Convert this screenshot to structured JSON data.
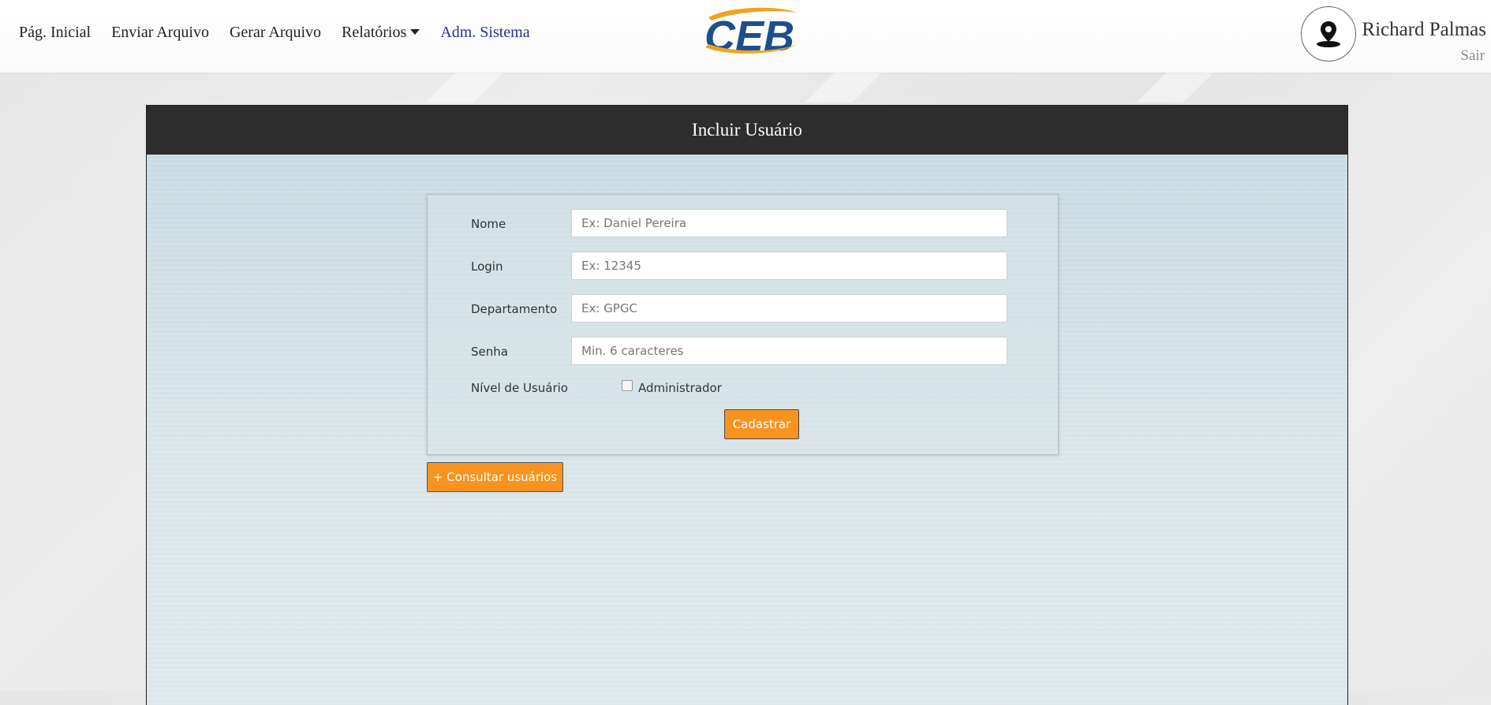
{
  "nav": {
    "items": [
      {
        "label": "Pág. Inicial"
      },
      {
        "label": "Enviar Arquivo"
      },
      {
        "label": "Gerar Arquivo"
      },
      {
        "label": "Relatórios"
      },
      {
        "label": "Adm. Sistema"
      }
    ]
  },
  "logo": {
    "text": "CEB",
    "primary_color": "#1d4f8f",
    "accent_color": "#f0a31c"
  },
  "user": {
    "name": "Richard Palmas",
    "logout_label": "Sair"
  },
  "panel": {
    "title": "Incluir Usuário"
  },
  "form": {
    "fields": [
      {
        "label": "Nome",
        "placeholder": "Ex: Daniel Pereira",
        "value": ""
      },
      {
        "label": "Login",
        "placeholder": "Ex: 12345",
        "value": ""
      },
      {
        "label": "Departamento",
        "placeholder": "Ex: GPGC",
        "value": ""
      },
      {
        "label": "Senha",
        "placeholder": "Min. 6 caracteres",
        "value": ""
      }
    ],
    "level_label": "Nível de Usuário",
    "admin_checkbox_label": "Administrador",
    "admin_checked": false,
    "submit_label": "Cadastrar"
  },
  "consult_button_label": "+ Consultar usuários",
  "colors": {
    "accent": "#f7931e",
    "header_bg": "#2d2d2d",
    "active_nav": "#2a2f8f"
  }
}
